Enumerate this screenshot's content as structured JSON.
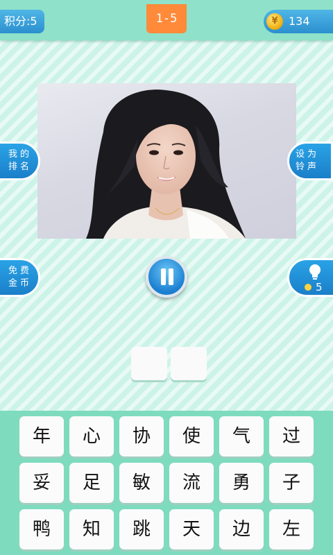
{
  "topbar": {
    "score_label": "积分:5",
    "level_label": "1-5",
    "coin_count": "134",
    "coin_symbol": "¥"
  },
  "side_buttons": {
    "my_rank": [
      "我的",
      "排名"
    ],
    "set_ringtone": [
      "设为",
      "铃声"
    ],
    "free_coins": [
      "免费",
      "金币"
    ],
    "hint_count": "5"
  },
  "answer": {
    "slots": [
      "",
      ""
    ]
  },
  "keyboard": {
    "rows": [
      [
        "年",
        "心",
        "协",
        "使",
        "气",
        "过"
      ],
      [
        "妥",
        "足",
        "敏",
        "流",
        "勇",
        "子"
      ],
      [
        "鸭",
        "知",
        "跳",
        "天",
        "边",
        "左"
      ]
    ]
  },
  "colors": {
    "background": "#cdf3e8",
    "topbar": "#8fe2c9",
    "blue_button": "#2b8fcf",
    "level_orange": "#ff8a3a",
    "keyboard_bg": "#7edbbe"
  }
}
